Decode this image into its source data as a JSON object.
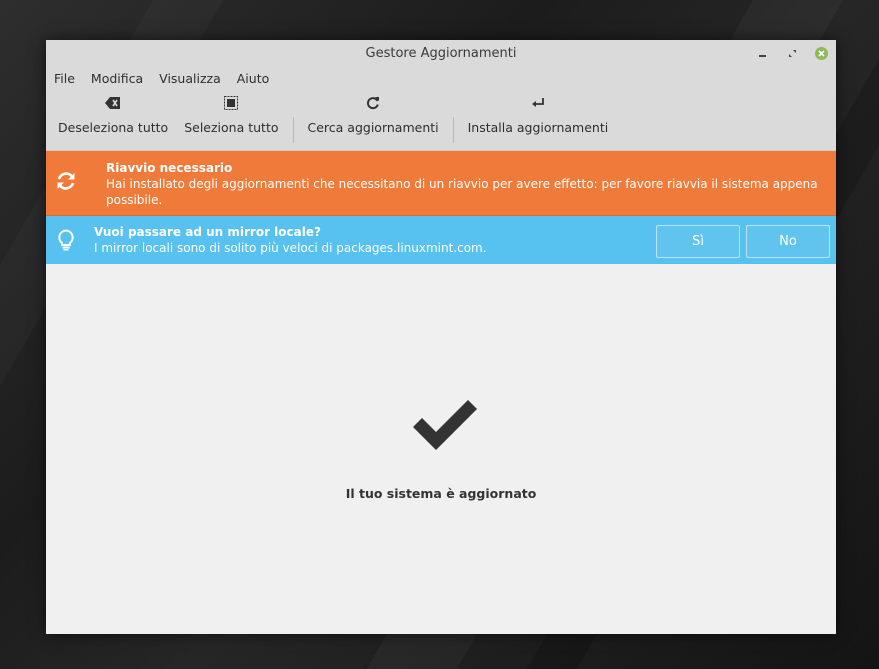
{
  "window": {
    "title": "Gestore Aggiornamenti"
  },
  "menubar": {
    "items": [
      "File",
      "Modifica",
      "Visualizza",
      "Aiuto"
    ]
  },
  "toolbar": {
    "deselect_all": {
      "label": "Deseleziona tutto",
      "icon": "backspace-icon"
    },
    "select_all": {
      "label": "Seleziona tutto",
      "icon": "select-all-icon"
    },
    "refresh": {
      "label": "Cerca aggiornamenti",
      "icon": "refresh-icon"
    },
    "install": {
      "label": "Installa aggiornamenti",
      "icon": "enter-icon"
    }
  },
  "infobar_restart": {
    "title": "Riavvio necessario",
    "message_line1": "Hai installato degli aggiornamenti che necessitano di un riavvio per avere effetto: per favore riavvia il sistema appena",
    "message_line2": "possibile.",
    "icon": "reboot-icon",
    "color": "#f07a39"
  },
  "infobar_mirror": {
    "title": "Vuoi passare ad un mirror locale?",
    "message": "I mirror locali sono di solito più veloci di packages.linuxmint.com.",
    "yes_label": "Sì",
    "no_label": "No",
    "icon": "lightbulb-icon",
    "color": "#57c1ef"
  },
  "status": {
    "message": "Il tuo sistema è aggiornato",
    "icon": "checkmark-icon"
  }
}
